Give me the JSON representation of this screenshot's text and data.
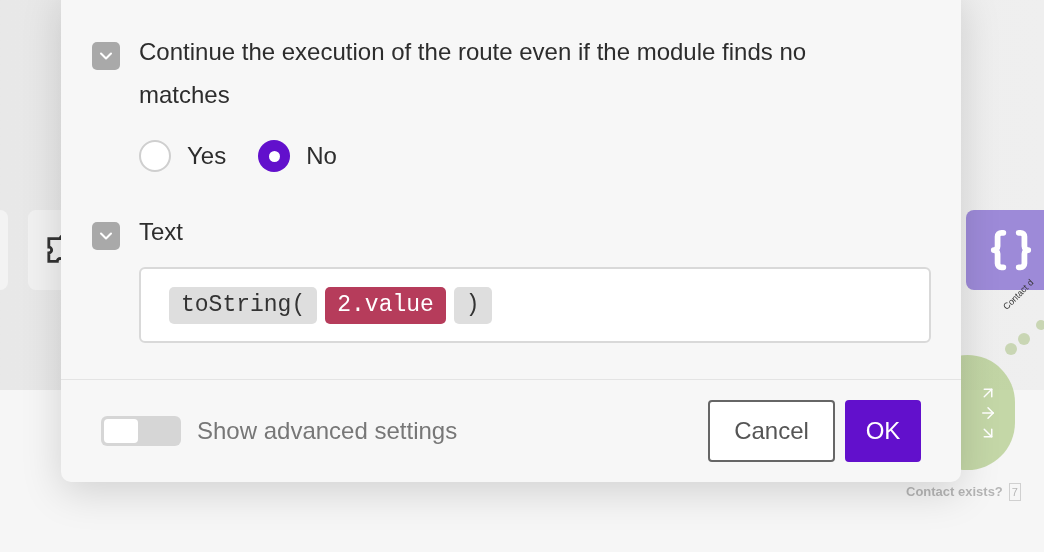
{
  "canvas": {
    "route_label": "Contact d",
    "node_label": "Contact exists?",
    "node_count": "7"
  },
  "sections": [
    {
      "kind": "radio",
      "label": "Continue the execution of the route even if the module finds no matches",
      "expanded": true,
      "choices": [
        {
          "label": "Yes",
          "selected": false
        },
        {
          "label": "No",
          "selected": true
        }
      ]
    },
    {
      "kind": "text",
      "label": "Text",
      "expanded": true,
      "tokens": [
        {
          "text": "toString(",
          "kind": "function"
        },
        {
          "text": "2.value",
          "kind": "variable"
        },
        {
          "text": ")",
          "kind": "function"
        }
      ]
    }
  ],
  "advanced": {
    "label": "Show advanced settings",
    "on": false
  },
  "buttons": [
    {
      "label": "Cancel",
      "kind": "secondary"
    },
    {
      "label": "OK",
      "kind": "primary"
    }
  ]
}
